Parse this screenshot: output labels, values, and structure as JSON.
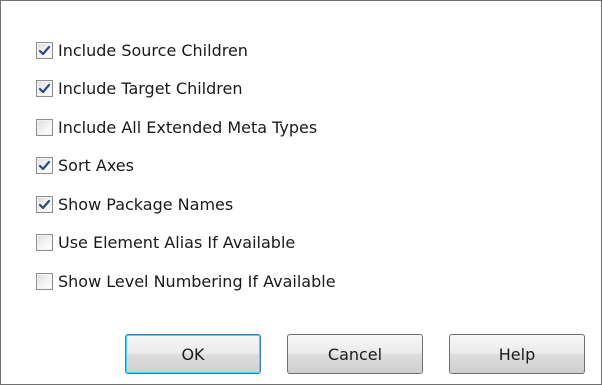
{
  "options": [
    {
      "label": "Include Source Children",
      "checked": true
    },
    {
      "label": "Include Target Children",
      "checked": true
    },
    {
      "label": "Include All Extended Meta Types",
      "checked": false
    },
    {
      "label": "Sort Axes",
      "checked": true
    },
    {
      "label": "Show Package Names",
      "checked": true
    },
    {
      "label": "Use Element Alias If Available",
      "checked": false
    },
    {
      "label": "Show Level Numbering If Available",
      "checked": false
    }
  ],
  "buttons": {
    "ok_label": "OK",
    "cancel_label": "Cancel",
    "help_label": "Help"
  },
  "colors": {
    "checkmark": "#2a4a8a",
    "default_button_border": "#3c7fb1"
  }
}
